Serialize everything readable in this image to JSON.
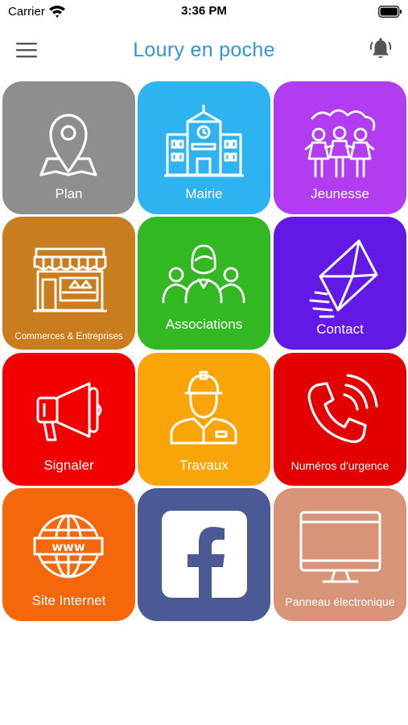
{
  "status_bar": {
    "carrier": "Carrier",
    "time": "3:36 PM"
  },
  "header": {
    "title": "Loury en poche",
    "menu_icon": "hamburger-menu-icon",
    "notification_icon": "bell-icon",
    "title_color": "#2f97d8"
  },
  "tiles": [
    {
      "label": "Plan",
      "icon": "map-pin-icon",
      "color": "#8e8e8e"
    },
    {
      "label": "Mairie",
      "icon": "town-hall-icon",
      "color": "#2fb3f0"
    },
    {
      "label": "Jeunesse",
      "icon": "children-group-icon",
      "color": "#b23cf0"
    },
    {
      "label": "Commerces & Entreprises",
      "icon": "storefront-icon",
      "color": "#c97d1e"
    },
    {
      "label": "Associations",
      "icon": "people-group-icon",
      "color": "#33b722"
    },
    {
      "label": "Contact",
      "icon": "envelope-icon",
      "color": "#6219e6"
    },
    {
      "label": "Signaler",
      "icon": "megaphone-icon",
      "color": "#f20000"
    },
    {
      "label": "Travaux",
      "icon": "worker-icon",
      "color": "#f9a50a"
    },
    {
      "label": "Numéros d'urgence",
      "icon": "phone-icon",
      "color": "#e20000"
    },
    {
      "label": "Site Internet",
      "icon": "globe-www-icon",
      "color": "#f4670a"
    },
    {
      "label": "",
      "icon": "facebook-icon",
      "color": "#4b5a95"
    },
    {
      "label": "Panneau électronique",
      "icon": "monitor-icon",
      "color": "#d89478"
    }
  ]
}
